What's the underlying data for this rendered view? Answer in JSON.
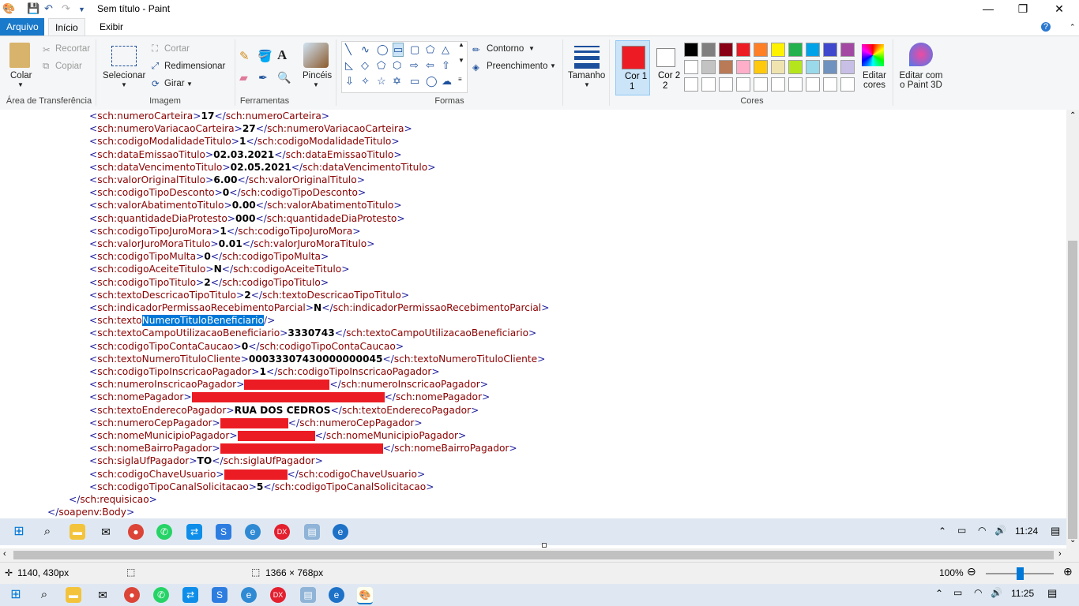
{
  "window": {
    "title": "Sem título - Paint",
    "minimize": "—",
    "restore": "❐",
    "close": "✕"
  },
  "tabs": [
    "Arquivo",
    "Início",
    "Exibir"
  ],
  "help_icon": "?",
  "ribbon": {
    "clipboard": {
      "paste": "Colar",
      "cut": "Recortar",
      "copy": "Copiar",
      "label": "Área de Transferência"
    },
    "image": {
      "select": "Selecionar",
      "crop": "Cortar",
      "resize": "Redimensionar",
      "rotate": "Girar",
      "label": "Imagem"
    },
    "tools": {
      "label": "Ferramentas"
    },
    "brushes": {
      "label": "Pincéis"
    },
    "shapes": {
      "outline": "Contorno",
      "fill": "Preenchimento",
      "label": "Formas"
    },
    "size": {
      "label": "Tamanho"
    },
    "colors": {
      "color1": "Cor 1",
      "color1_line2": "1",
      "color2": "Cor 2",
      "color2_line2": "2",
      "color1_hex": "#ed1c24",
      "color2_hex": "#ffffff",
      "edit": "Editar cores",
      "edit_line2": "cores",
      "paint3d": "Editar com o Paint 3D",
      "label": "Cores",
      "palette_row1": [
        "#000000",
        "#7f7f7f",
        "#880015",
        "#ed1c24",
        "#ff7f27",
        "#fff200",
        "#22b14c",
        "#00a2e8",
        "#3f48cc",
        "#a349a4"
      ],
      "palette_row2": [
        "#ffffff",
        "#c3c3c3",
        "#b97a57",
        "#ffaec9",
        "#ffc90e",
        "#efe4b0",
        "#b5e61d",
        "#99d9ea",
        "#7092be",
        "#c8bfe7"
      ]
    }
  },
  "code_lines": [
    {
      "i": 113,
      "tag": "sch:numeroCarteira",
      "val": "17"
    },
    {
      "i": 113,
      "tag": "sch:numeroVariacaoCarteira",
      "val": "27"
    },
    {
      "i": 113,
      "tag": "sch:codigoModalidadeTitulo",
      "val": "1"
    },
    {
      "i": 113,
      "tag": "sch:dataEmissaoTitulo",
      "val": "02.03.2021"
    },
    {
      "i": 113,
      "tag": "sch:dataVencimentoTitulo",
      "val": "02.05.2021"
    },
    {
      "i": 113,
      "tag": "sch:valorOriginalTitulo",
      "val": "6.00"
    },
    {
      "i": 113,
      "tag": "sch:codigoTipoDesconto",
      "val": "0"
    },
    {
      "i": 113,
      "tag": "sch:valorAbatimentoTitulo",
      "val": "0.00"
    },
    {
      "i": 113,
      "tag": "sch:quantidadeDiaProtesto",
      "val": "000"
    },
    {
      "i": 113,
      "tag": "sch:codigoTipoJuroMora",
      "val": "1"
    },
    {
      "i": 113,
      "tag": "sch:valorJuroMoraTitulo",
      "val": "0.01"
    },
    {
      "i": 113,
      "tag": "sch:codigoTipoMulta",
      "val": "0"
    },
    {
      "i": 113,
      "tag": "sch:codigoAceiteTitulo",
      "val": "N"
    },
    {
      "i": 113,
      "tag": "sch:codigoTipoTitulo",
      "val": "2"
    },
    {
      "i": 113,
      "tag": "sch:textoDescricaoTipoTitulo",
      "val": "2"
    },
    {
      "i": 113,
      "tag": "sch:indicadorPermissaoRecebimentoParcial",
      "val": "N"
    },
    {
      "i": 113,
      "special": "selfclose",
      "pre": "sch:texto",
      "sel": "NumeroTituloBeneficiario"
    },
    {
      "i": 113,
      "tag": "sch:textoCampoUtilizacaoBeneficiario",
      "val": "3330743"
    },
    {
      "i": 113,
      "tag": "sch:codigoTipoContaCaucao",
      "val": "0"
    },
    {
      "i": 113,
      "tag": "sch:textoNumeroTituloCliente",
      "val": "00033307430000000045"
    },
    {
      "i": 113,
      "tag": "sch:codigoTipoInscricaoPagador",
      "val": "1"
    },
    {
      "i": 113,
      "tag": "sch:numeroInscricaoPagador",
      "redact": 108
    },
    {
      "i": 113,
      "tag": "sch:nomePagador",
      "redact": 244
    },
    {
      "i": 113,
      "tag": "sch:textoEnderecoPagador",
      "val": "RUA DOS CEDROS"
    },
    {
      "i": 113,
      "tag": "sch:numeroCepPagador",
      "redact": 86
    },
    {
      "i": 113,
      "tag": "sch:nomeMunicipioPagador",
      "redact": 98
    },
    {
      "i": 113,
      "tag": "sch:nomeBairroPagador",
      "redact": 206
    },
    {
      "i": 113,
      "tag": "sch:siglaUfPagador",
      "val": "TO"
    },
    {
      "i": 113,
      "tag": "sch:codigoChaveUsuario",
      "redact": 80
    },
    {
      "i": 113,
      "tag": "sch:codigoTipoCanalSolicitacao",
      "val": "5"
    },
    {
      "i": 87,
      "special": "close",
      "text": "sch:requisicao"
    },
    {
      "i": 60,
      "special": "close",
      "text": "soapenv:Body"
    }
  ],
  "image_taskbar": {
    "time": "11:24"
  },
  "status": {
    "cursor": "1140, 430px",
    "canvas_size": "1366 × 768px",
    "zoom": "100%"
  },
  "os_taskbar": {
    "time": "11:25"
  }
}
